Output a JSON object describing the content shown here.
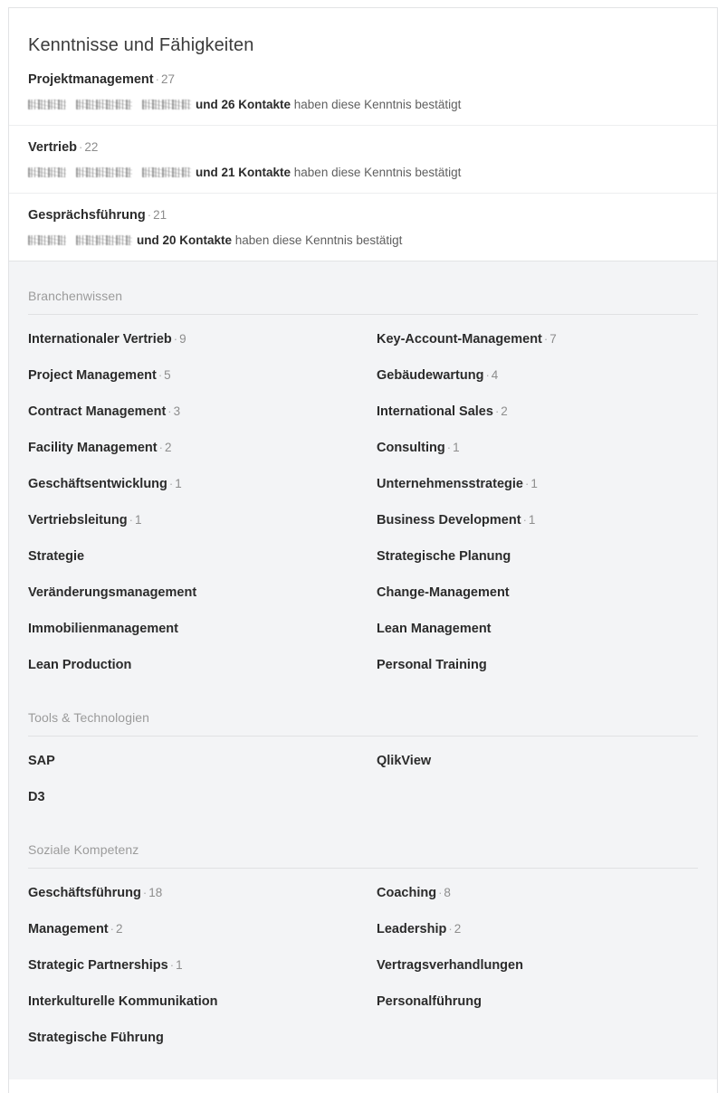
{
  "card": {
    "title": "Kenntnisse und Fähigkeiten"
  },
  "endorsed_skills": [
    {
      "name": "Projektmanagement",
      "separator": "·",
      "count": "27",
      "endorsers_redacted": [
        "name-1",
        "name-2",
        "name-3"
      ],
      "endorsement_bold": "und 26 Kontakte",
      "endorsement_rest": "haben diese Kenntnis bestätigt"
    },
    {
      "name": "Vertrieb",
      "separator": "·",
      "count": "22",
      "endorsers_redacted": [
        "name-1",
        "name-2",
        "name-3"
      ],
      "endorsement_bold": "und 21 Kontakte",
      "endorsement_rest": "haben diese Kenntnis bestätigt"
    },
    {
      "name": "Gesprächsführung",
      "separator": "·",
      "count": "21",
      "endorsers_redacted": [
        "name-1",
        "name-2"
      ],
      "endorsement_bold": "und 20 Kontakte",
      "endorsement_rest": "haben diese Kenntnis bestätigt"
    }
  ],
  "categories": [
    {
      "title": "Branchenwissen",
      "items": [
        {
          "name": "Internationaler Vertrieb",
          "separator": "·",
          "count": "9"
        },
        {
          "name": "Key-Account-Management",
          "separator": "·",
          "count": "7"
        },
        {
          "name": "Project Management",
          "separator": "·",
          "count": "5"
        },
        {
          "name": "Gebäudewartung",
          "separator": "·",
          "count": "4"
        },
        {
          "name": "Contract Management",
          "separator": "·",
          "count": "3"
        },
        {
          "name": "International Sales",
          "separator": "·",
          "count": "2"
        },
        {
          "name": "Facility Management",
          "separator": "·",
          "count": "2"
        },
        {
          "name": "Consulting",
          "separator": "·",
          "count": "1"
        },
        {
          "name": "Geschäftsentwicklung",
          "separator": "·",
          "count": "1"
        },
        {
          "name": "Unternehmensstrategie",
          "separator": "·",
          "count": "1"
        },
        {
          "name": "Vertriebsleitung",
          "separator": "·",
          "count": "1"
        },
        {
          "name": "Business Development",
          "separator": "·",
          "count": "1"
        },
        {
          "name": "Strategie",
          "separator": "",
          "count": ""
        },
        {
          "name": "Strategische Planung",
          "separator": "",
          "count": ""
        },
        {
          "name": "Veränderungsmanagement",
          "separator": "",
          "count": ""
        },
        {
          "name": "Change-Management",
          "separator": "",
          "count": ""
        },
        {
          "name": "Immobilienmanagement",
          "separator": "",
          "count": ""
        },
        {
          "name": "Lean Management",
          "separator": "",
          "count": ""
        },
        {
          "name": "Lean Production",
          "separator": "",
          "count": ""
        },
        {
          "name": "Personal Training",
          "separator": "",
          "count": ""
        }
      ]
    },
    {
      "title": "Tools & Technologien",
      "items": [
        {
          "name": "SAP",
          "separator": "",
          "count": ""
        },
        {
          "name": "QlikView",
          "separator": "",
          "count": ""
        },
        {
          "name": "D3",
          "separator": "",
          "count": ""
        }
      ]
    },
    {
      "title": "Soziale Kompetenz",
      "items": [
        {
          "name": "Geschäftsführung",
          "separator": "·",
          "count": "18"
        },
        {
          "name": "Coaching",
          "separator": "·",
          "count": "8"
        },
        {
          "name": "Management",
          "separator": "·",
          "count": "2"
        },
        {
          "name": "Leadership",
          "separator": "·",
          "count": "2"
        },
        {
          "name": "Strategic Partnerships",
          "separator": "·",
          "count": "1"
        },
        {
          "name": "Vertragsverhandlungen",
          "separator": "",
          "count": ""
        },
        {
          "name": "Interkulturelle Kommunikation",
          "separator": "",
          "count": ""
        },
        {
          "name": "Personalführung",
          "separator": "",
          "count": ""
        },
        {
          "name": "Strategische Führung",
          "separator": "",
          "count": ""
        }
      ]
    }
  ],
  "colors": {
    "card_background": "#ffffff",
    "section_background": "#f3f4f6",
    "border": "#e2e3e5",
    "title_text": "#3b3b3b",
    "skill_text": "#2b2b2b",
    "count_text": "#8d8d8d",
    "section_header_text": "#9b9b9b"
  }
}
